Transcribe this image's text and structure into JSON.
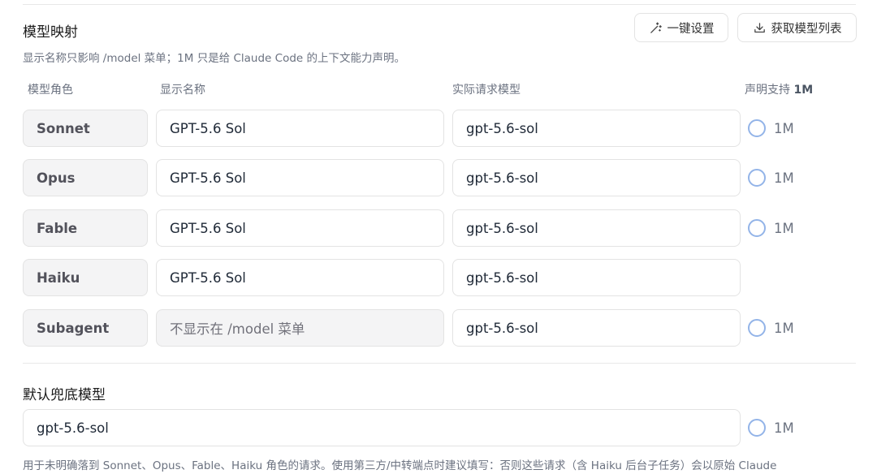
{
  "mapping": {
    "title": "模型映射",
    "subtitle": "显示名称只影响 /model 菜单；1M 只是给 Claude Code 的上下文能力声明。",
    "buttons": {
      "auto_setup": "一键设置",
      "auto_setup_icon": "magic-wand-icon",
      "fetch_models": "获取模型列表",
      "fetch_models_icon": "download-icon"
    },
    "headers": {
      "role": "模型角色",
      "display_name": "显示名称",
      "request_model": "实际请求模型",
      "declare_prefix": "声明支持 ",
      "declare_suffix": "1M"
    },
    "rows": [
      {
        "role": "Sonnet",
        "display_name": "GPT-5.6 Sol",
        "request_model": "gpt-5.6-sol",
        "has_1m": true,
        "check_label": "1M"
      },
      {
        "role": "Opus",
        "display_name": "GPT-5.6 Sol",
        "request_model": "gpt-5.6-sol",
        "has_1m": true,
        "check_label": "1M"
      },
      {
        "role": "Fable",
        "display_name": "GPT-5.6 Sol",
        "request_model": "gpt-5.6-sol",
        "has_1m": true,
        "check_label": "1M"
      },
      {
        "role": "Haiku",
        "display_name": "GPT-5.6 Sol",
        "request_model": "gpt-5.6-sol",
        "has_1m": false,
        "check_label": ""
      },
      {
        "role": "Subagent",
        "display_name": "不显示在 /model 菜单",
        "request_model": "gpt-5.6-sol",
        "has_1m": true,
        "check_label": "1M",
        "display_disabled": true
      }
    ]
  },
  "fallback": {
    "title": "默认兜底模型",
    "value": "gpt-5.6-sol",
    "check_label": "1M",
    "footnote": "用于未明确落到 Sonnet、Opus、Fable、Haiku 角色的请求。使用第三方/中转端点时建议填写：否则这些请求（含 Haiku 后台子任务）会以原始 Claude"
  },
  "colors": {
    "checkbox_border": "#93b4e8",
    "role_bg": "#f4f4f5"
  }
}
